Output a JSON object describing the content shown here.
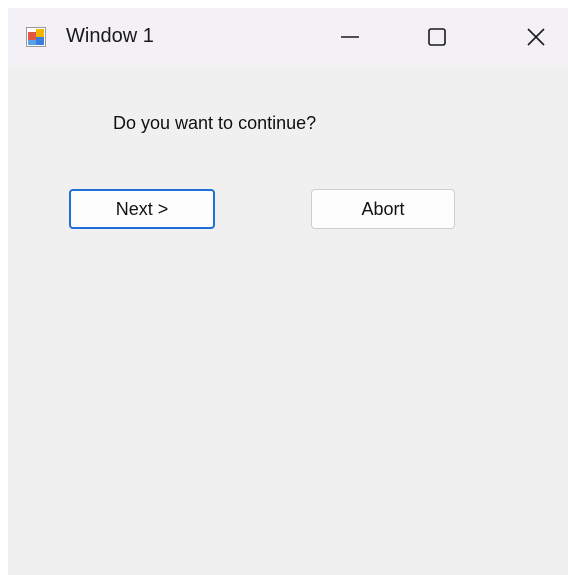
{
  "window": {
    "title": "Window 1",
    "app_icon": "winforms-app-icon",
    "controls": {
      "minimize_icon": "minimize-icon",
      "maximize_icon": "maximize-icon",
      "close_icon": "close-icon"
    }
  },
  "dialog": {
    "question": "Do you want to continue?",
    "next_label": "Next >",
    "abort_label": "Abort"
  },
  "colors": {
    "titlebar_bg": "#f3f0f6",
    "client_bg": "#f0f0f0",
    "default_button_border": "#1f6fd6"
  }
}
